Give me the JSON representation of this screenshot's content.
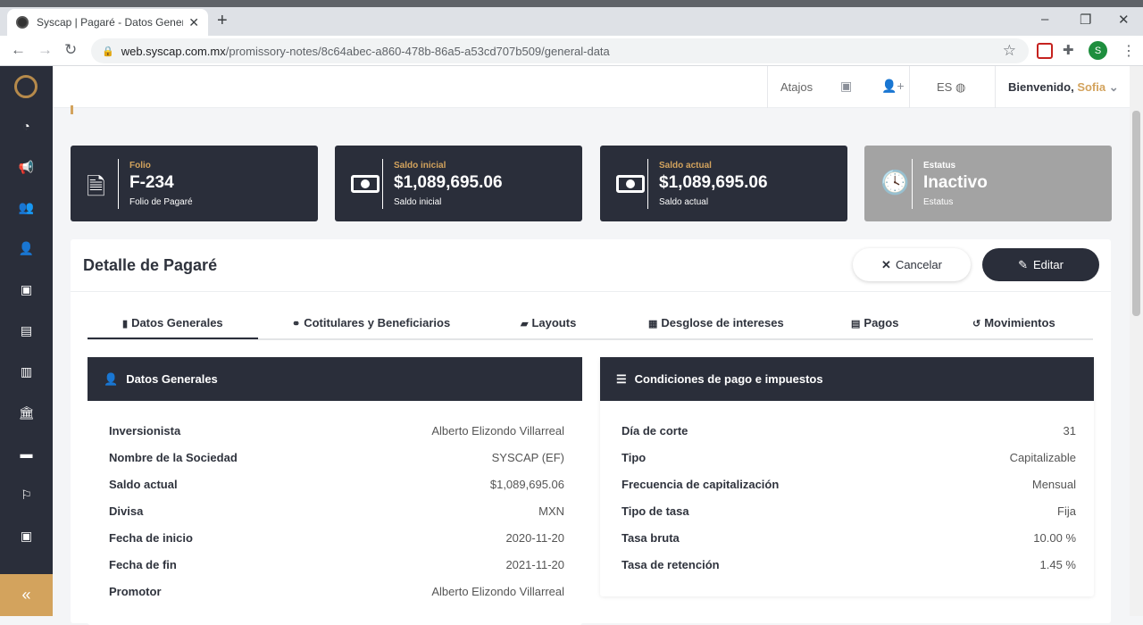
{
  "browser": {
    "tab_title": "Syscap | Pagaré - Datos Generales",
    "tab_close": "✕",
    "new_tab": "+",
    "url_domain": "web.syscap.com.mx",
    "url_path": "/promissory-notes/8c64abec-a860-478b-86a5-a53cd707b509/general-data",
    "profile_initial": "S"
  },
  "header": {
    "shortcuts_label": "Atajos",
    "language": "ES",
    "welcome_label": "Bienvenido,",
    "user_name": "Sofia"
  },
  "cards": [
    {
      "label": "Folio",
      "value": "F-234",
      "sub": "Folio de Pagaré",
      "icon": "document-icon"
    },
    {
      "label": "Saldo inicial",
      "value": "$1,089,695.06",
      "sub": "Saldo inicial",
      "icon": "money-icon"
    },
    {
      "label": "Saldo actual",
      "value": "$1,089,695.06",
      "sub": "Saldo actual",
      "icon": "money-icon"
    },
    {
      "label": "Estatus",
      "value": "Inactivo",
      "sub": "Estatus",
      "icon": "clock-icon"
    }
  ],
  "detail": {
    "title": "Detalle de Pagaré",
    "cancel_label": "Cancelar",
    "edit_label": "Editar"
  },
  "tabs": [
    {
      "label": "Datos Generales",
      "active": true
    },
    {
      "label": "Cotitulares y Beneficiarios"
    },
    {
      "label": "Layouts"
    },
    {
      "label": "Desglose de intereses"
    },
    {
      "label": "Pagos"
    },
    {
      "label": "Movimientos"
    }
  ],
  "general": {
    "title": "Datos Generales",
    "rows": [
      {
        "k": "Inversionista",
        "v": "Alberto Elizondo Villarreal"
      },
      {
        "k": "Nombre de la Sociedad",
        "v": "SYSCAP (EF)"
      },
      {
        "k": "Saldo actual",
        "v": "$1,089,695.06"
      },
      {
        "k": "Divisa",
        "v": "MXN"
      },
      {
        "k": "Fecha de inicio",
        "v": "2020-11-20"
      },
      {
        "k": "Fecha de fin",
        "v": "2021-11-20"
      },
      {
        "k": "Promotor",
        "v": "Alberto Elizondo Villarreal"
      }
    ]
  },
  "conditions": {
    "title": "Condiciones de pago e impuestos",
    "rows": [
      {
        "k": "Día de corte",
        "v": "31"
      },
      {
        "k": "Tipo",
        "v": "Capitalizable"
      },
      {
        "k": "Frecuencia de capitalización",
        "v": "Mensual"
      },
      {
        "k": "Tipo de tasa",
        "v": "Fija"
      },
      {
        "k": "Tasa bruta",
        "v": "10.00 %"
      },
      {
        "k": "Tasa de retención",
        "v": "1.45 %"
      }
    ]
  },
  "colors": {
    "dark": "#2a2e3a",
    "gold": "#d3a35d",
    "inactive_gray": "#a3a3a3"
  }
}
